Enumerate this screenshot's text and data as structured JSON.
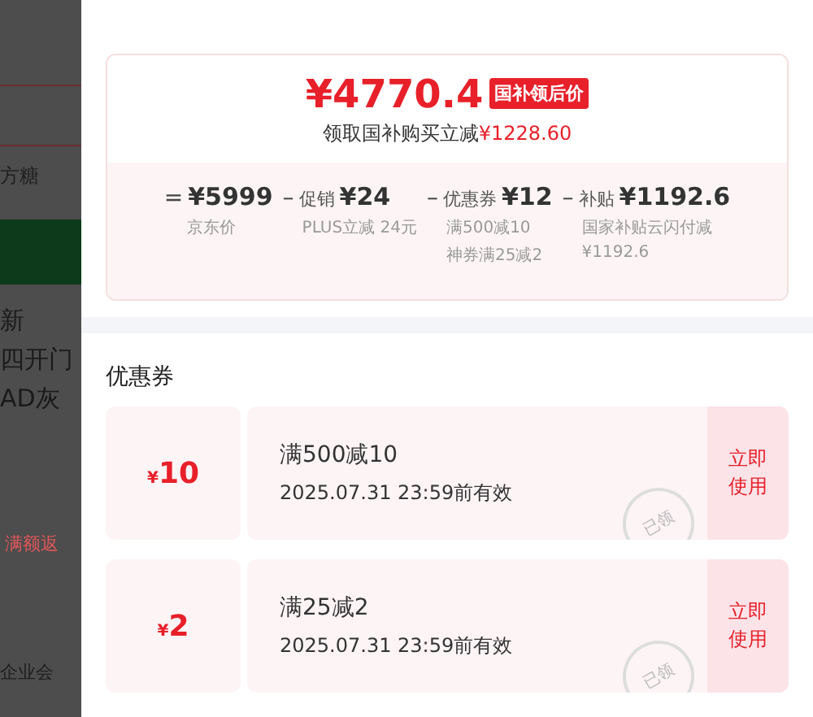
{
  "background_page": {
    "texts": [
      {
        "kind": "rule"
      },
      {
        "kind": "rule"
      },
      {
        "kind": "text",
        "text": "方糖"
      },
      {
        "kind": "band"
      },
      {
        "kind": "title",
        "text": "新"
      },
      {
        "kind": "title",
        "text": "四开门"
      },
      {
        "kind": "title",
        "text": "AD灰"
      },
      {
        "kind": "promo",
        "text": "满额返"
      },
      {
        "kind": "text",
        "text": "企业会"
      }
    ]
  },
  "price_card": {
    "price": "¥4770.4",
    "badge": "国补领后价",
    "subtitle": "领取国补购买立减",
    "subtitle_amount": "¥1228.60",
    "breakdown": [
      {
        "op": "=",
        "amount": "¥5999",
        "notes": [
          "京东价"
        ]
      },
      {
        "op": "–",
        "label": "促销",
        "amount": "¥24",
        "notes": [
          "PLUS立减 24元"
        ]
      },
      {
        "op": "–",
        "label": "优惠券",
        "amount": "¥12",
        "notes": [
          "满500减10",
          "神券满25减2"
        ]
      },
      {
        "op": "–",
        "label": "补贴",
        "amount": "¥1192.6",
        "notes": [
          "国家补贴云闪付减",
          "¥1192.6"
        ]
      }
    ]
  },
  "coupons_section": {
    "title": "优惠券",
    "coupons": [
      {
        "currency": "¥",
        "amount": "10",
        "title": "满500减10",
        "validity": "2025.07.31 23:59前有效",
        "stamp": "已领",
        "action": "立即使用"
      },
      {
        "currency": "¥",
        "amount": "2",
        "title": "满25减2",
        "validity": "2025.07.31 23:59前有效",
        "stamp": "已领",
        "action": "立即使用"
      }
    ]
  }
}
